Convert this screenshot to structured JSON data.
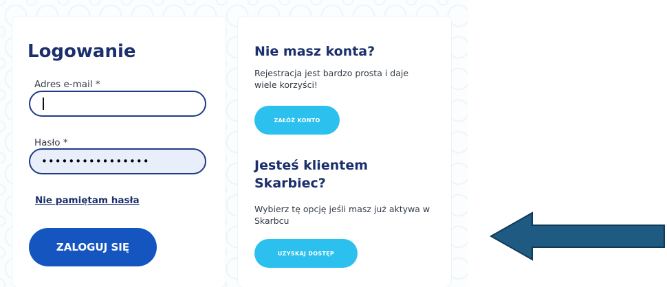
{
  "login": {
    "title": "Logowanie",
    "email_label": "Adres e-mail *",
    "email_value": "",
    "password_label": "Hasło *",
    "password_value": "••••••••••••••••",
    "forgot_link": "Nie pamiętam hasła",
    "submit_label": "ZALOGUJ SIĘ"
  },
  "register": {
    "title": "Nie masz konta?",
    "text": "Rejestracja jest bardzo prosta i daje wiele korzyści!",
    "button_label": "ZAŁÓŻ KONTO"
  },
  "client": {
    "title": "Jesteś klientem Skarbiec?",
    "text": "Wybierz tę opcję jeśli masz już aktywa w Skarbcu",
    "button_label": "UZYSKAJ DOSTĘP"
  },
  "colors": {
    "primary_button": "#1455c0",
    "secondary_button": "#2bc0ee",
    "heading": "#1a2f6b",
    "arrow_fill": "#1e5a82"
  },
  "icons": {
    "arrow": "arrow-left-icon"
  }
}
